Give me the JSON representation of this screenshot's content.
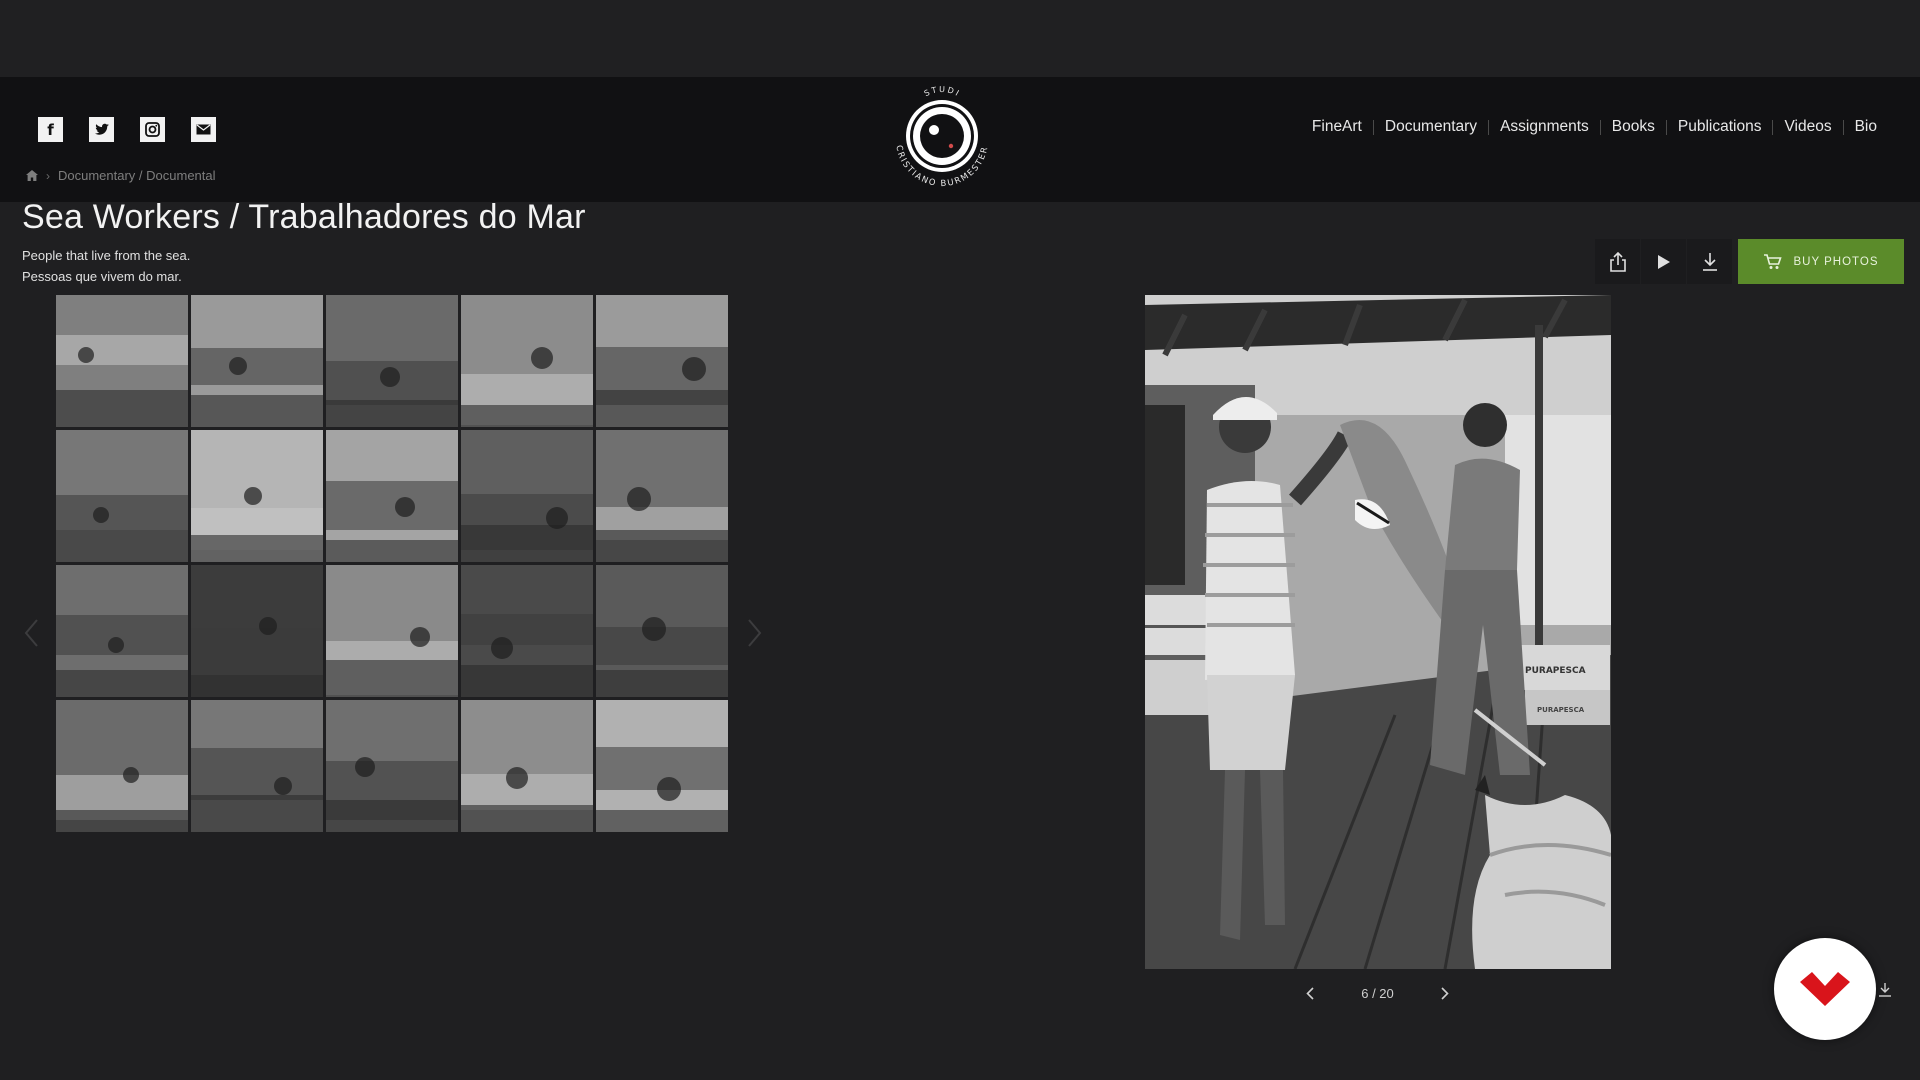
{
  "social": [
    {
      "name": "facebook-icon",
      "glyph": "f"
    },
    {
      "name": "twitter-icon",
      "glyph": "🐦"
    },
    {
      "name": "instagram-icon",
      "glyph": "◎"
    },
    {
      "name": "email-icon",
      "glyph": "✉"
    }
  ],
  "logo": {
    "top_text": "STUDIO",
    "ring_text": "CRISTIANO BURMESTER"
  },
  "nav": [
    {
      "label": "FineArt"
    },
    {
      "label": "Documentary"
    },
    {
      "label": "Assignments"
    },
    {
      "label": "Books"
    },
    {
      "label": "Publications"
    },
    {
      "label": "Videos"
    },
    {
      "label": "Bio"
    }
  ],
  "breadcrumb": {
    "path": "Documentary / Documental"
  },
  "gallery": {
    "title": "Sea Workers / Trabalhadores do Mar",
    "description_line1": "People that live from the sea.",
    "description_line2": "Pessoas que vivem do mar."
  },
  "toolbar": {
    "buy_label": "BUY PHOTOS"
  },
  "thumbnails": [
    {
      "name": "thumb-fishermen-net",
      "tone": "#7f7f7f"
    },
    {
      "name": "thumb-coast-rocks",
      "tone": "#9a9a9a"
    },
    {
      "name": "thumb-fish-closeup",
      "tone": "#6a6a6a"
    },
    {
      "name": "thumb-sailboat",
      "tone": "#8c8c8c"
    },
    {
      "name": "thumb-cliff-boat",
      "tone": "#9b9b9b"
    },
    {
      "name": "thumb-shark-men",
      "tone": "#777777"
    },
    {
      "name": "thumb-white-beach",
      "tone": "#b5b5b5"
    },
    {
      "name": "thumb-fish-net-house",
      "tone": "#a4a4a4"
    },
    {
      "name": "thumb-canoe-men",
      "tone": "#5f5f5f"
    },
    {
      "name": "thumb-mangrove-worker",
      "tone": "#707070"
    },
    {
      "name": "thumb-mangrove-trees",
      "tone": "#6e6e6e"
    },
    {
      "name": "thumb-village-night",
      "tone": "#3c3c3c"
    },
    {
      "name": "thumb-two-men-portrait",
      "tone": "#8a8a8a"
    },
    {
      "name": "thumb-lighthouse",
      "tone": "#4a4a4a"
    },
    {
      "name": "thumb-wave-surface",
      "tone": "#5a5a5a"
    },
    {
      "name": "thumb-trawler-boat",
      "tone": "#6b6b6b"
    },
    {
      "name": "thumb-man-shirt",
      "tone": "#777777"
    },
    {
      "name": "thumb-moored-boats",
      "tone": "#6f6f6f"
    },
    {
      "name": "thumb-surf-boat",
      "tone": "#8d8d8d"
    },
    {
      "name": "thumb-boat-shore",
      "tone": "#b1b1b1"
    }
  ],
  "viewer": {
    "crate_label_1": "PURAPESCA",
    "crate_label_2": "PURAPESCA"
  },
  "pager": {
    "counter": "6 / 20"
  },
  "colors": {
    "buy_green": "#5b8b2a",
    "badge_red": "#d9141b",
    "background": "#1f1f21"
  }
}
